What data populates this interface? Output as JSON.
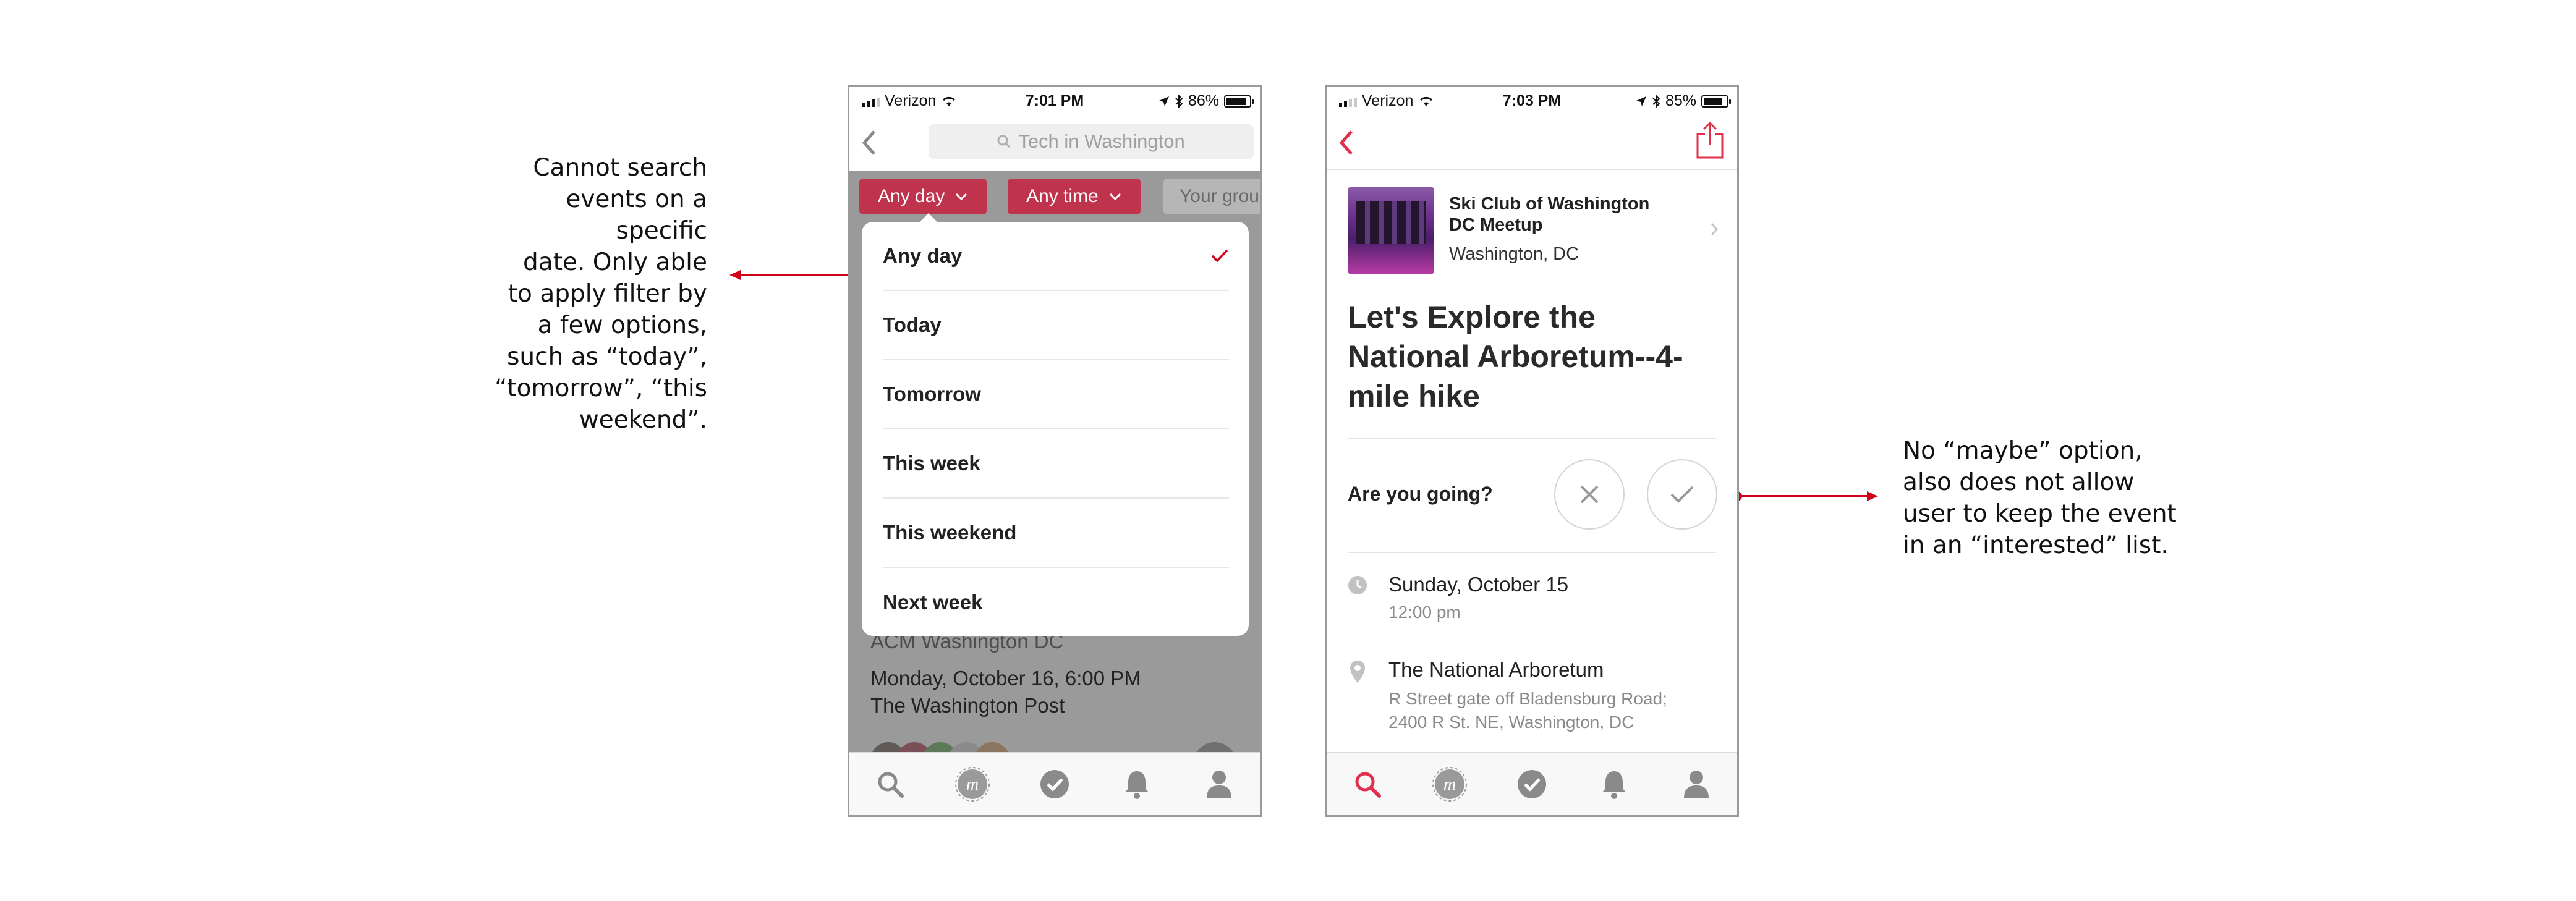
{
  "annotations": {
    "left": [
      "Cannot search",
      "events on a specific",
      "date. Only able",
      "to apply filter by",
      "a few options,",
      "such as “today”,",
      "“tomorrow”, “this",
      "weekend”."
    ],
    "right": [
      "No “maybe” option,",
      "also does not allow",
      "user to keep the event",
      "in an “interested” list."
    ],
    "accent_color": "#d0021b"
  },
  "phone_left": {
    "status": {
      "carrier": "Verizon",
      "time": "7:01 PM",
      "battery": "86%",
      "battery_level": 0.86
    },
    "search_placeholder": "Tech in Washington",
    "filters": [
      "Any day",
      "Any time",
      "Your grou"
    ],
    "dropdown": {
      "items": [
        "Any day",
        "Today",
        "Tomorrow",
        "This week",
        "This weekend",
        "Next week"
      ],
      "selected_index": 0
    },
    "behind": {
      "group": "ACM Washington DC",
      "datetime": "Monday, October 16, 6:00 PM",
      "venue": "The Washington Post"
    },
    "tabs": [
      "search-icon",
      "meetup-logo-icon",
      "check-circle-icon",
      "bell-icon",
      "profile-icon"
    ]
  },
  "phone_right": {
    "status": {
      "carrier": "Verizon",
      "time": "7:03 PM",
      "battery": "85%",
      "battery_level": 0.85
    },
    "group": {
      "name_line1": "Ski Club of Washington",
      "name_line2": "DC Meetup",
      "location": "Washington, DC"
    },
    "event_title": [
      "Let's Explore the",
      "National Arboretum--4-",
      "mile hike"
    ],
    "rsvp_question": "Are you going?",
    "date": {
      "day": "Sunday, October 15",
      "time": "12:00 pm"
    },
    "place": {
      "name": "The National Arboretum",
      "address1": "R Street gate off Bladensburg Road;",
      "address2": "2400 R St. NE, Washington, DC"
    },
    "brand_color": "#e0304e",
    "tabs": [
      "search-icon",
      "meetup-logo-icon",
      "check-circle-icon",
      "bell-icon",
      "profile-icon"
    ]
  }
}
